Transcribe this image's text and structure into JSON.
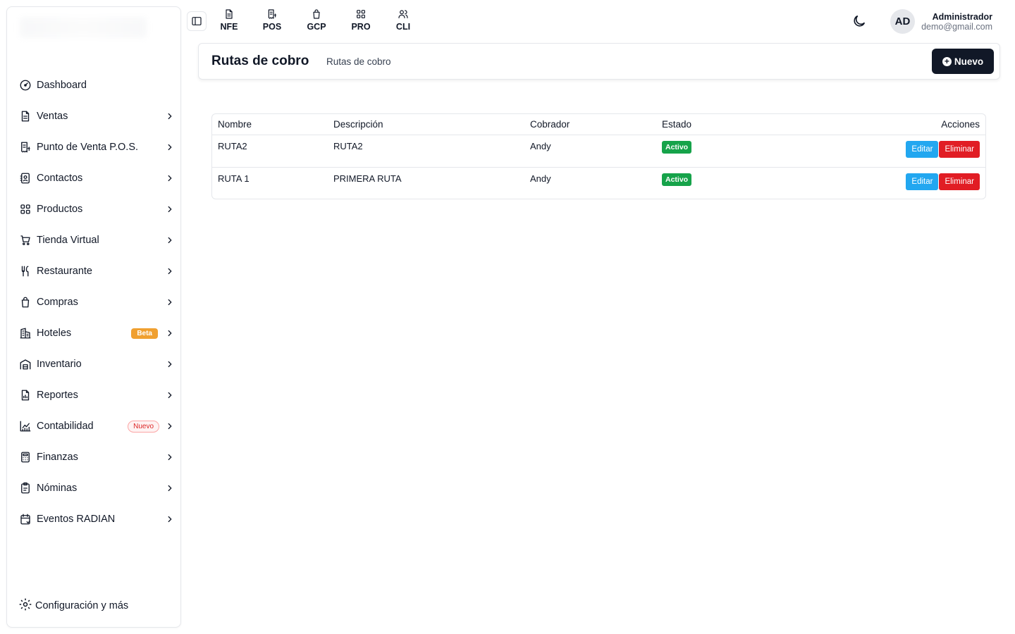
{
  "sidebar": {
    "items": [
      {
        "label": "Dashboard",
        "icon": "gauge-icon",
        "chevron": false
      },
      {
        "label": "Ventas",
        "icon": "document-icon",
        "chevron": true
      },
      {
        "label": "Punto de Venta P.O.S.",
        "icon": "receipt-icon",
        "chevron": true
      },
      {
        "label": "Contactos",
        "icon": "contacts-icon",
        "chevron": true
      },
      {
        "label": "Productos",
        "icon": "grid-icon",
        "chevron": true
      },
      {
        "label": "Tienda Virtual",
        "icon": "cart-icon",
        "chevron": true
      },
      {
        "label": "Restaurante",
        "icon": "utensils-icon",
        "chevron": true
      },
      {
        "label": "Compras",
        "icon": "bag-icon",
        "chevron": true
      },
      {
        "label": "Hoteles",
        "icon": "building-icon",
        "chevron": true,
        "badge": "Beta"
      },
      {
        "label": "Inventario",
        "icon": "warehouse-icon",
        "chevron": true
      },
      {
        "label": "Reportes",
        "icon": "report-icon",
        "chevron": true
      },
      {
        "label": "Contabilidad",
        "icon": "chart-icon",
        "chevron": true,
        "badge": "Nuevo"
      },
      {
        "label": "Finanzas",
        "icon": "calculator-icon",
        "chevron": true
      },
      {
        "label": "Nóminas",
        "icon": "clipboard-icon",
        "chevron": true
      },
      {
        "label": "Eventos RADIAN",
        "icon": "calendar-icon",
        "chevron": true
      }
    ],
    "config_label": "Configuración y más"
  },
  "topnav": [
    {
      "label": "NFE",
      "icon": "document-icon"
    },
    {
      "label": "POS",
      "icon": "receipt-icon"
    },
    {
      "label": "GCP",
      "icon": "bag-icon"
    },
    {
      "label": "PRO",
      "icon": "grid-icon"
    },
    {
      "label": "CLI",
      "icon": "users-icon"
    }
  ],
  "user": {
    "initials": "AD",
    "name": "Administrador",
    "email": "demo@gmail.com"
  },
  "header": {
    "title": "Rutas de cobro",
    "subtitle": "Rutas de cobro",
    "new_label": "Nuevo"
  },
  "table": {
    "columns": [
      "Nombre",
      "Descripción",
      "Cobrador",
      "Estado",
      "Acciones"
    ],
    "rows": [
      {
        "nombre": "RUTA2",
        "descripcion": "RUTA2",
        "cobrador": "Andy",
        "estado": "Activo"
      },
      {
        "nombre": "RUTA 1",
        "descripcion": "PRIMERA RUTA",
        "cobrador": "Andy",
        "estado": "Activo"
      }
    ],
    "edit_label": "Editar",
    "delete_label": "Eliminar"
  },
  "colors": {
    "primary": "#111827",
    "status_active": "#16a34a",
    "edit": "#22a7f0",
    "delete": "#e11d24",
    "beta_badge": "#f0a030"
  }
}
